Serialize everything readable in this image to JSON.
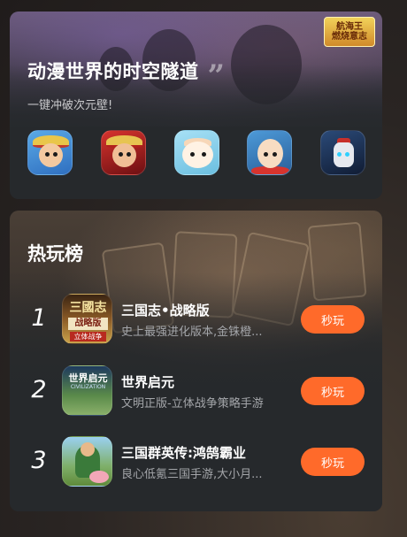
{
  "banner": {
    "title": "动漫世界的时空隧道",
    "subtitle": "一键冲破次元壁!",
    "logo_text": "航海王\n燃烧意志",
    "quote_icon": "quote-icon",
    "apps": [
      {
        "name": "one-piece-luffy-app-icon"
      },
      {
        "name": "one-piece-official-app-icon"
      },
      {
        "name": "cute-beast-app-icon"
      },
      {
        "name": "one-punch-man-app-icon"
      },
      {
        "name": "gundam-app-icon"
      }
    ]
  },
  "hot_list": {
    "title": "热玩榜",
    "items": [
      {
        "rank": "1",
        "name": "三国志•战略版",
        "desc": "史上最强进化版本,金铢橙...",
        "button": "秒玩",
        "icon_text_top": "三國志",
        "icon_text_mid": "战略版",
        "icon_text_bot": "立体战争"
      },
      {
        "rank": "2",
        "name": "世界启元",
        "desc": "文明正版-立体战争策略手游",
        "button": "秒玩",
        "icon_text_top": "世界启元",
        "icon_text_mid": "CIVILIZATION"
      },
      {
        "rank": "3",
        "name": "三国群英传:鸿鹄霸业",
        "desc": "良心低氪三国手游,大小月...",
        "button": "秒玩"
      }
    ]
  },
  "colors": {
    "accent": "#ff6a2a",
    "card_bg": "#26292c",
    "page_bg": "#2a2523"
  }
}
